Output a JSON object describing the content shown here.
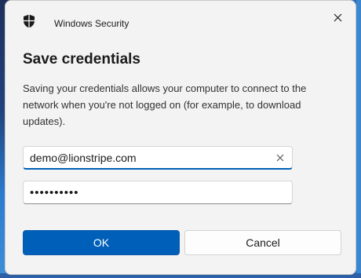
{
  "window": {
    "app_title": "Windows Security",
    "close_icon": "close-icon",
    "app_icon": "shield-icon"
  },
  "dialog": {
    "heading": "Save credentials",
    "description": "Saving your credentials allows your computer to connect to the network when you're not logged on (for example, to download updates)."
  },
  "form": {
    "username_value": "demo@lionstripe.com",
    "password_value": "••••••••••",
    "clear_icon": "clear-x-icon"
  },
  "buttons": {
    "ok_label": "OK",
    "cancel_label": "Cancel"
  },
  "colors": {
    "accent": "#005fb8",
    "dialog_bg": "#f3f3f3"
  }
}
